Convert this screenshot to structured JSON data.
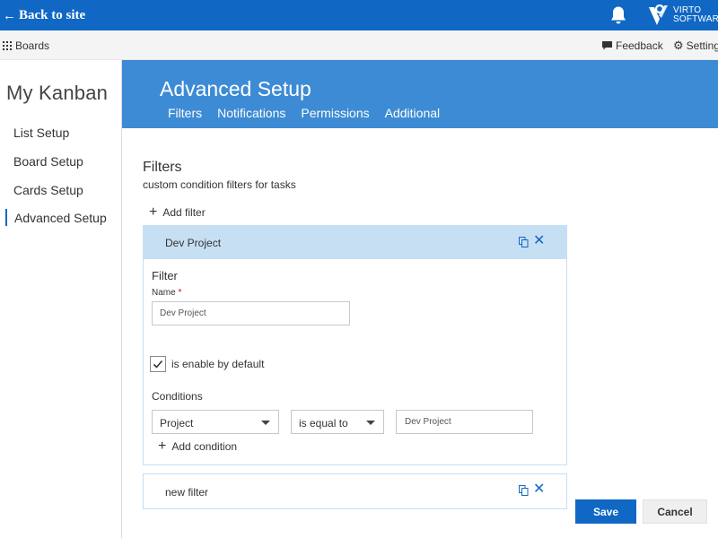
{
  "topbar": {
    "back_label": "Back to site",
    "logo_text_1": "VIRTO",
    "logo_text_2": "SOFTWARE",
    "accent": "#1068c4"
  },
  "subbar": {
    "boards_label": "Boards",
    "feedback_label": "Feedback",
    "settings_label": "Settings"
  },
  "sidebar": {
    "app_title": "My Kanban",
    "items": [
      {
        "label": "List Setup"
      },
      {
        "label": "Board Setup"
      },
      {
        "label": "Cards Setup"
      },
      {
        "label": "Advanced Setup",
        "active": true
      }
    ]
  },
  "header": {
    "title": "Advanced Setup",
    "tabs": [
      {
        "label": "Filters"
      },
      {
        "label": "Notifications"
      },
      {
        "label": "Permissions"
      },
      {
        "label": "Additional"
      }
    ]
  },
  "main": {
    "section_title": "Filters",
    "section_subtitle": "custom condition filters for tasks",
    "add_filter_label": "Add filter",
    "filters": [
      {
        "name": "Dev Project",
        "expanded": true,
        "form_title": "Filter",
        "name_label": "Name",
        "required_mark": "*",
        "name_value": "Dev Project",
        "enabled_label": "is enable by default",
        "enabled": true,
        "conditions_label": "Conditions",
        "condition": {
          "field": "Project",
          "operator": "is equal to",
          "value": "Dev Project"
        },
        "add_condition_label": "Add condition"
      },
      {
        "name": "new filter",
        "expanded": false
      }
    ]
  },
  "footer": {
    "save_label": "Save",
    "cancel_label": "Cancel"
  },
  "icons": {
    "back": "arrow-left-icon",
    "bell": "bell-icon",
    "boards": "grid-icon",
    "feedback": "chat-icon",
    "settings": "gear-icon",
    "add": "plus-icon",
    "copy": "copy-icon",
    "delete": "close-icon",
    "dropdown": "chevron-down-icon",
    "check": "check-icon"
  }
}
